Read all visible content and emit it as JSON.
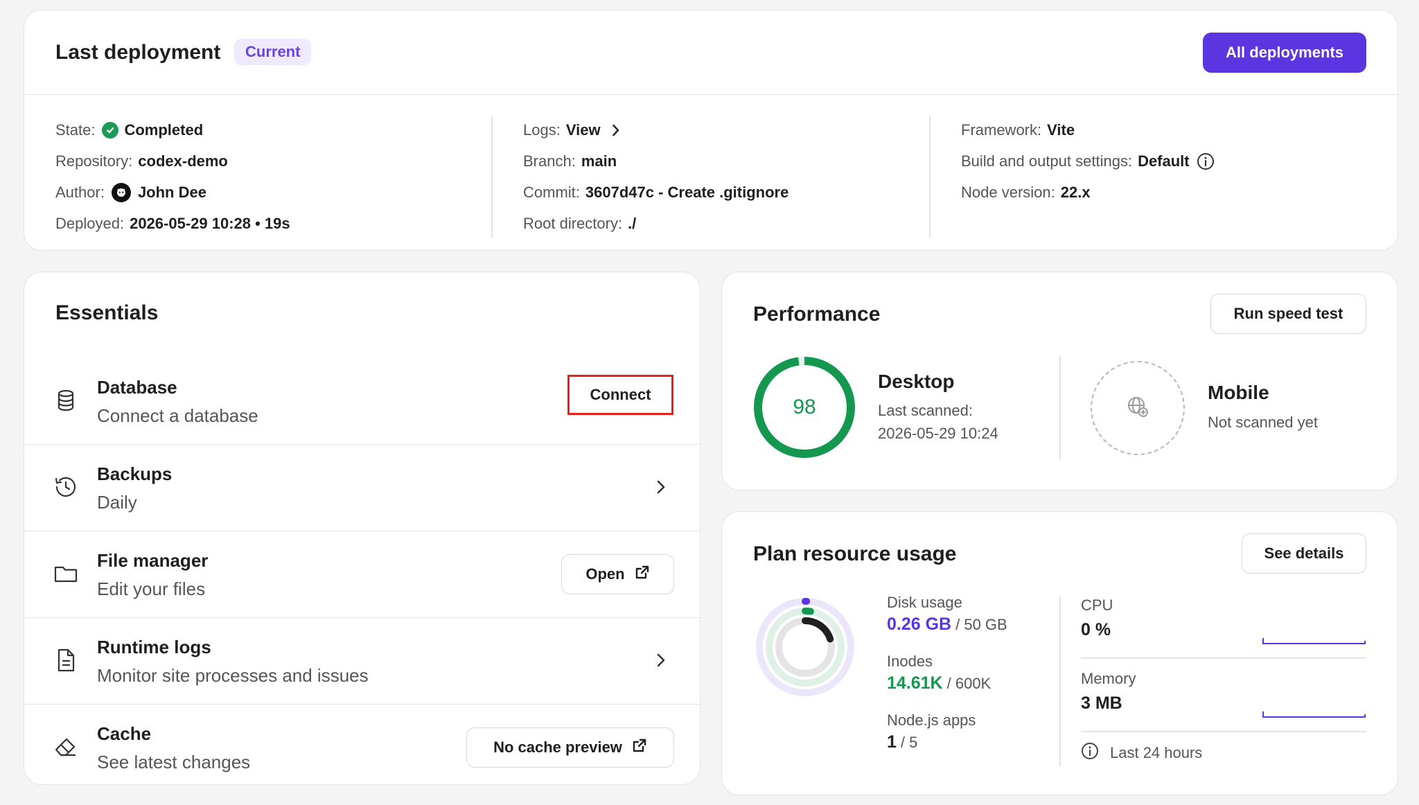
{
  "deployment": {
    "title": "Last deployment",
    "badge": "Current",
    "all_deployments_label": "All deployments",
    "state_label": "State:",
    "state_value": "Completed",
    "repository_label": "Repository:",
    "repository_value": "codex-demo",
    "author_label": "Author:",
    "author_value": "John Dee",
    "deployed_label": "Deployed:",
    "deployed_value": "2026-05-29 10:28 • 19s",
    "logs_label": "Logs:",
    "logs_value": "View",
    "branch_label": "Branch:",
    "branch_value": "main",
    "commit_label": "Commit:",
    "commit_value": "3607d47c - Create .gitignore",
    "root_label": "Root directory:",
    "root_value": "./",
    "framework_label": "Framework:",
    "framework_value": "Vite",
    "build_label": "Build and output settings:",
    "build_value": "Default",
    "node_label": "Node version:",
    "node_value": "22.x"
  },
  "essentials": {
    "title": "Essentials",
    "items": [
      {
        "name": "Database",
        "desc": "Connect a database",
        "icon": "database-icon",
        "action": "Connect"
      },
      {
        "name": "Backups",
        "desc": "Daily",
        "icon": "history-icon"
      },
      {
        "name": "File manager",
        "desc": "Edit your files",
        "icon": "folder-icon",
        "action": "Open"
      },
      {
        "name": "Runtime logs",
        "desc": "Monitor site processes and issues",
        "icon": "document-icon"
      },
      {
        "name": "Cache",
        "desc": "See latest changes",
        "icon": "eraser-icon",
        "action": "No cache preview"
      }
    ]
  },
  "performance": {
    "title": "Performance",
    "run_label": "Run speed test",
    "desktop": {
      "label": "Desktop",
      "score": "98",
      "score_fraction": 0.98,
      "scanned_label": "Last scanned:",
      "scanned_value": "2026-05-29 10:24"
    },
    "mobile": {
      "label": "Mobile",
      "status": "Not scanned yet"
    }
  },
  "plan": {
    "title": "Plan resource usage",
    "details_label": "See details",
    "disk_label": "Disk usage",
    "disk_used": "0.26 GB",
    "disk_total": "/ 50 GB",
    "disk_fraction": 0.0052,
    "inodes_label": "Inodes",
    "inodes_used": "14.61K",
    "inodes_total": "/ 600K",
    "inodes_fraction": 0.0244,
    "apps_label": "Node.js apps",
    "apps_used": "1",
    "apps_total": "/ 5",
    "apps_fraction": 0.2,
    "cpu_label": "CPU",
    "cpu_value": "0 %",
    "memory_label": "Memory",
    "memory_value": "3 MB",
    "footnote": "Last 24 hours"
  },
  "colors": {
    "accent": "#5a35e0",
    "success": "#14984f",
    "highlight_border": "#e0241b"
  }
}
